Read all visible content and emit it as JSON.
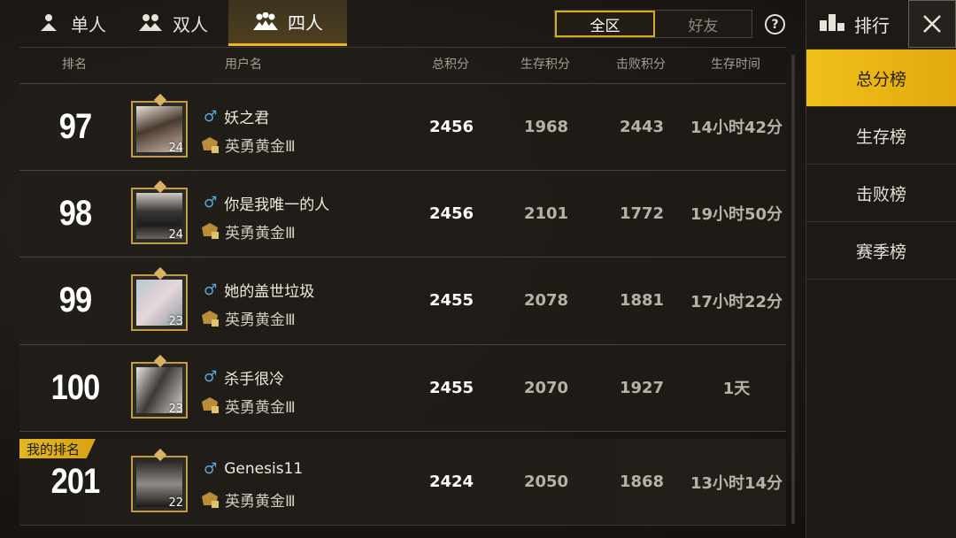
{
  "mode_tabs": [
    {
      "label": "单人",
      "icon": "single-player-icon",
      "active": false
    },
    {
      "label": "双人",
      "icon": "duo-icon",
      "active": false
    },
    {
      "label": "四人",
      "icon": "squad-icon",
      "active": true
    }
  ],
  "region": {
    "all": "全区",
    "friends": "好友",
    "selected": "全区"
  },
  "help_label": "?",
  "columns": {
    "rank": "排名",
    "username": "用户名",
    "total": "总积分",
    "survival": "生存积分",
    "kills": "击败积分",
    "time": "生存时间"
  },
  "rows": [
    {
      "rank": "97",
      "name": "妖之君",
      "tier": "英勇黄金Ⅲ",
      "level": "24",
      "total": "2456",
      "survival": "1968",
      "kills": "2443",
      "time": "14小时42分"
    },
    {
      "rank": "98",
      "name": "你是我唯一的人",
      "tier": "英勇黄金Ⅲ",
      "level": "24",
      "total": "2456",
      "survival": "2101",
      "kills": "1772",
      "time": "19小时50分"
    },
    {
      "rank": "99",
      "name": "她的盖世垃圾",
      "tier": "英勇黄金Ⅲ",
      "level": "23",
      "total": "2455",
      "survival": "2078",
      "kills": "1881",
      "time": "17小时22分"
    },
    {
      "rank": "100",
      "name": "杀手很冷",
      "tier": "英勇黄金Ⅲ",
      "level": "23",
      "total": "2455",
      "survival": "2070",
      "kills": "1927",
      "time": "1天"
    }
  ],
  "my_rank": {
    "tag": "我的排名",
    "rank": "201",
    "name": "Genesis11",
    "tier": "英勇黄金Ⅲ",
    "level": "22",
    "total": "2424",
    "survival": "2050",
    "kills": "1868",
    "time": "13小时14分"
  },
  "panel": {
    "title": "排行",
    "tabs": [
      "总分榜",
      "生存榜",
      "击败榜",
      "赛季榜"
    ],
    "active_tab": "总分榜"
  },
  "colors": {
    "accent": "#e8b61f",
    "male": "#5aa8d8",
    "frame": "#c59a45"
  }
}
